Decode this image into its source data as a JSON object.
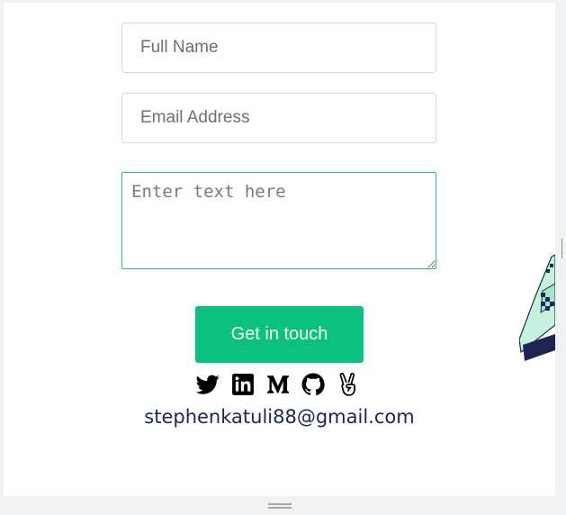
{
  "form": {
    "name_placeholder": "Full Name",
    "email_placeholder": "Email Address",
    "message_placeholder": "Enter text here",
    "submit_label": "Get in touch"
  },
  "social": [
    "twitter-icon",
    "linkedin-icon",
    "medium-icon",
    "github-icon",
    "victory-hand-icon"
  ],
  "contact": {
    "email": "stephenkatuli88@gmail.com"
  },
  "colors": {
    "accent": "#0bc180",
    "email_text": "#1e2454",
    "focus_border": "#1fbf8a"
  }
}
